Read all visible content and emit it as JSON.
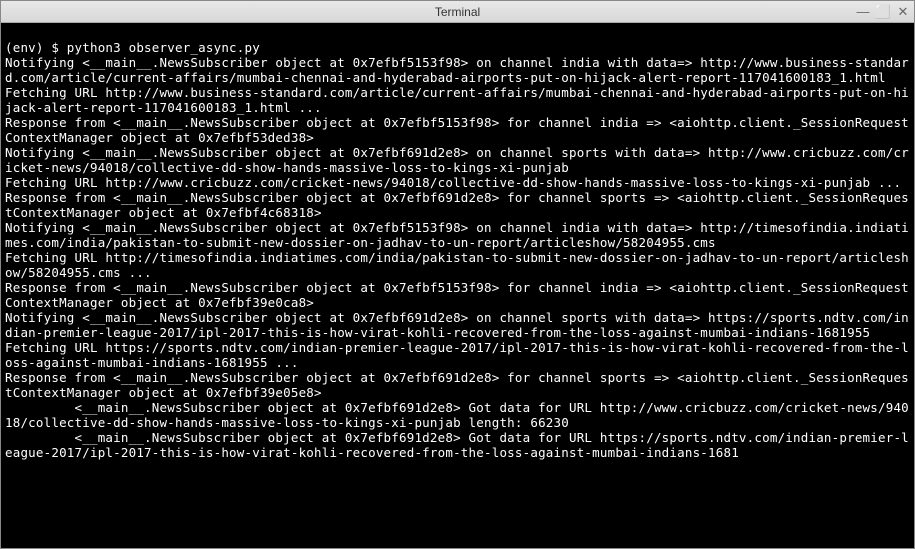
{
  "window": {
    "title": "Terminal",
    "minimize": "—",
    "maximize": "⬜",
    "close": "✕"
  },
  "terminal": {
    "prompt": "(env) $ python3 observer_async.py",
    "lines": [
      "Notifying <__main__.NewsSubscriber object at 0x7efbf5153f98> on channel india with data=> http://www.business-standard.com/article/current-affairs/mumbai-chennai-and-hyderabad-airports-put-on-hijack-alert-report-117041600183_1.html",
      "Fetching URL http://www.business-standard.com/article/current-affairs/mumbai-chennai-and-hyderabad-airports-put-on-hijack-alert-report-117041600183_1.html ...",
      "Response from <__main__.NewsSubscriber object at 0x7efbf5153f98> for channel india => <aiohttp.client._SessionRequestContextManager object at 0x7efbf53ded38>",
      "Notifying <__main__.NewsSubscriber object at 0x7efbf691d2e8> on channel sports with data=> http://www.cricbuzz.com/cricket-news/94018/collective-dd-show-hands-massive-loss-to-kings-xi-punjab",
      "Fetching URL http://www.cricbuzz.com/cricket-news/94018/collective-dd-show-hands-massive-loss-to-kings-xi-punjab ...",
      "Response from <__main__.NewsSubscriber object at 0x7efbf691d2e8> for channel sports => <aiohttp.client._SessionRequestContextManager object at 0x7efbf4c68318>",
      "Notifying <__main__.NewsSubscriber object at 0x7efbf5153f98> on channel india with data=> http://timesofindia.indiatimes.com/india/pakistan-to-submit-new-dossier-on-jadhav-to-un-report/articleshow/58204955.cms",
      "Fetching URL http://timesofindia.indiatimes.com/india/pakistan-to-submit-new-dossier-on-jadhav-to-un-report/articleshow/58204955.cms ...",
      "Response from <__main__.NewsSubscriber object at 0x7efbf5153f98> for channel india => <aiohttp.client._SessionRequestContextManager object at 0x7efbf39e0ca8>",
      "Notifying <__main__.NewsSubscriber object at 0x7efbf691d2e8> on channel sports with data=> https://sports.ndtv.com/indian-premier-league-2017/ipl-2017-this-is-how-virat-kohli-recovered-from-the-loss-against-mumbai-indians-1681955",
      "Fetching URL https://sports.ndtv.com/indian-premier-league-2017/ipl-2017-this-is-how-virat-kohli-recovered-from-the-loss-against-mumbai-indians-1681955 ...",
      "Response from <__main__.NewsSubscriber object at 0x7efbf691d2e8> for channel sports => <aiohttp.client._SessionRequestContextManager object at 0x7efbf39e05e8>",
      "         <__main__.NewsSubscriber object at 0x7efbf691d2e8> Got data for URL http://www.cricbuzz.com/cricket-news/94018/collective-dd-show-hands-massive-loss-to-kings-xi-punjab length: 66230",
      "         <__main__.NewsSubscriber object at 0x7efbf691d2e8> Got data for URL https://sports.ndtv.com/indian-premier-league-2017/ipl-2017-this-is-how-virat-kohli-recovered-from-the-loss-against-mumbai-indians-1681"
    ]
  }
}
